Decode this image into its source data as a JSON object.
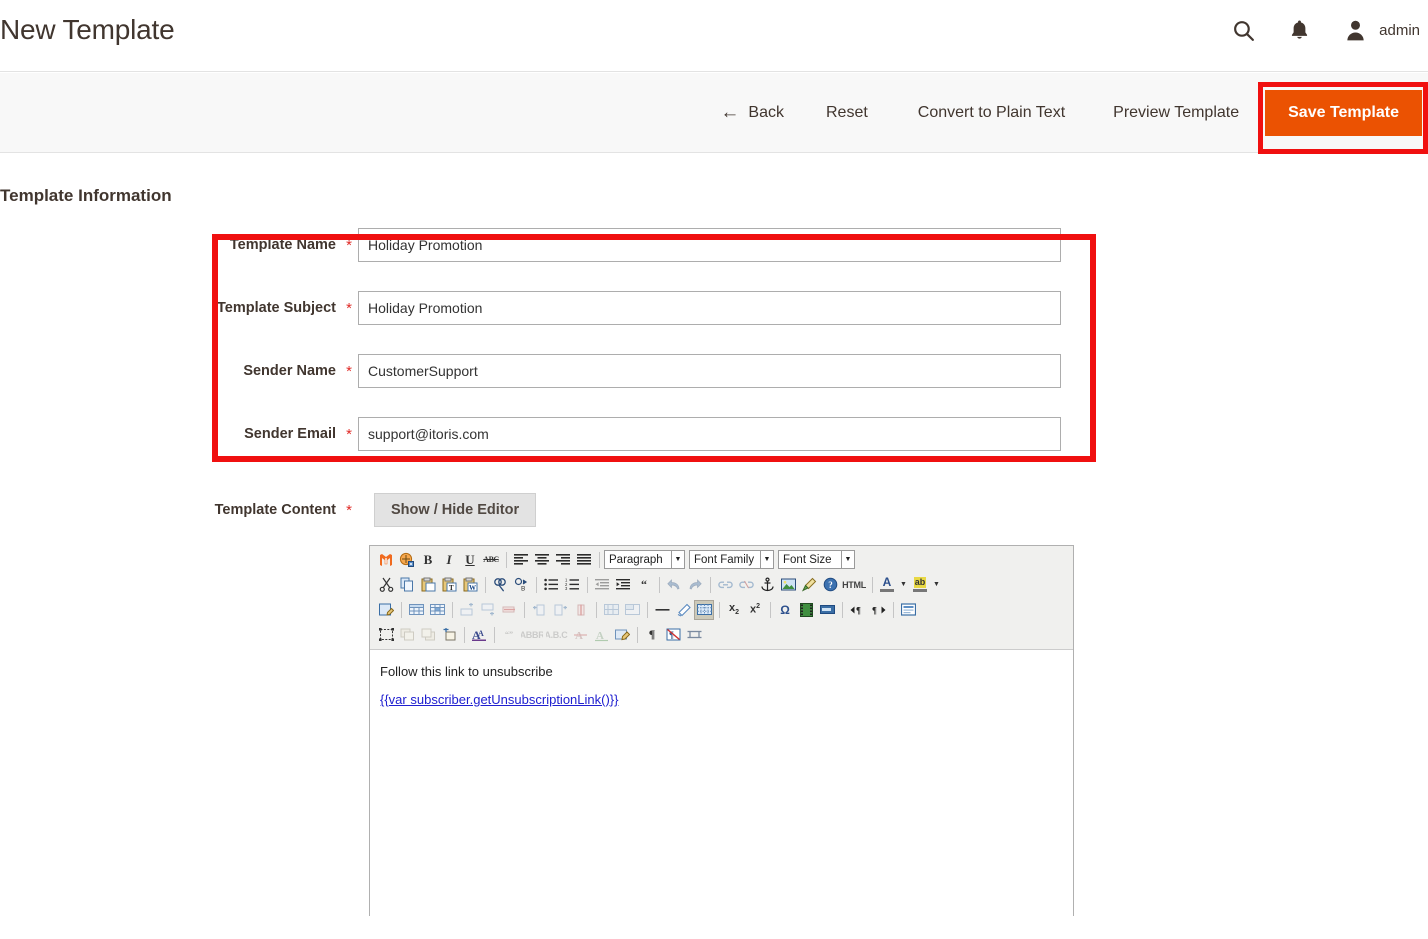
{
  "header": {
    "title": "New Template",
    "search_icon": "search-icon",
    "notifications_icon": "bell-icon",
    "user_icon": "user-avatar-icon",
    "admin_label": "admin"
  },
  "action_bar": {
    "back_label": "Back",
    "back_arrow": "←",
    "reset_label": "Reset",
    "convert_label": "Convert to Plain Text",
    "preview_label": "Preview Template",
    "save_label": "Save Template",
    "save_button_color": "#eb5202",
    "highlight_color": "#f01010"
  },
  "section": {
    "title": "Template Information"
  },
  "form": {
    "required_marker": "*",
    "fields": [
      {
        "label": "Template Name",
        "value": "Holiday Promotion",
        "placeholder": ""
      },
      {
        "label": "Template Subject",
        "value": "Holiday Promotion",
        "placeholder": ""
      },
      {
        "label": "Sender Name",
        "value": "CustomerSupport",
        "placeholder": ""
      },
      {
        "label": "Sender Email",
        "value": "support@itoris.com",
        "placeholder": ""
      }
    ]
  },
  "template_content": {
    "label": "Template Content",
    "required_marker": "*",
    "toggle_button_label": "Show / Hide Editor"
  },
  "editor": {
    "selects": [
      {
        "name": "paragraph-format",
        "value": "Paragraph"
      },
      {
        "name": "font-family",
        "value": "Font Family"
      },
      {
        "name": "font-size",
        "value": "Font Size"
      }
    ],
    "html_button_label": "HTML",
    "rows": [
      {
        "icons": [
          "magento-variable-icon",
          "magento-widget-icon",
          "bold-icon",
          "italic-icon",
          "underline-icon",
          "strikethrough-icon",
          "align-left-icon",
          "align-center-icon",
          "align-right-icon",
          "align-justify-icon"
        ]
      },
      {
        "icons": [
          "cut-icon",
          "copy-icon",
          "paste-icon",
          "paste-as-text-icon",
          "paste-from-word-icon",
          "find-icon",
          "find-replace-icon",
          "bullet-list-icon",
          "numbered-list-icon",
          "outdent-icon",
          "indent-icon",
          "blockquote-icon",
          "undo-icon",
          "redo-icon",
          "link-icon",
          "unlink-icon",
          "anchor-icon",
          "insert-image-icon",
          "cleanup-icon",
          "help-icon",
          "html-source-icon",
          "text-color-icon",
          "background-color-icon"
        ]
      },
      {
        "icons": [
          "edit-table-icon",
          "table-properties-icon",
          "table-cell-properties-icon",
          "insert-row-before-icon",
          "insert-row-after-icon",
          "delete-row-icon",
          "insert-column-before-icon",
          "insert-column-after-icon",
          "delete-column-icon",
          "split-cell-icon",
          "merge-cell-icon",
          "horizontal-rule-icon",
          "remove-format-icon",
          "visual-aid-icon",
          "subscript-icon",
          "superscript-icon",
          "special-character-icon",
          "insert-media-icon",
          "insert-date-icon",
          "ltr-icon",
          "rtl-icon",
          "insert-layer-icon"
        ]
      },
      {
        "icons": [
          "select-area-icon",
          "move-forward-icon",
          "move-backward-icon",
          "insert-layer-box-icon",
          "style-props-icon",
          "citation-icon",
          "abbreviation-icon",
          "acronym-icon",
          "delete-text-icon",
          "insert-text-icon",
          "attributes-icon",
          "paragraph-mark-icon",
          "visual-chars-icon",
          "page-break-icon"
        ]
      }
    ],
    "content": {
      "paragraph": "Follow this link to unsubscribe",
      "link_text": "{{var subscriber.getUnsubscriptionLink()}}"
    }
  }
}
